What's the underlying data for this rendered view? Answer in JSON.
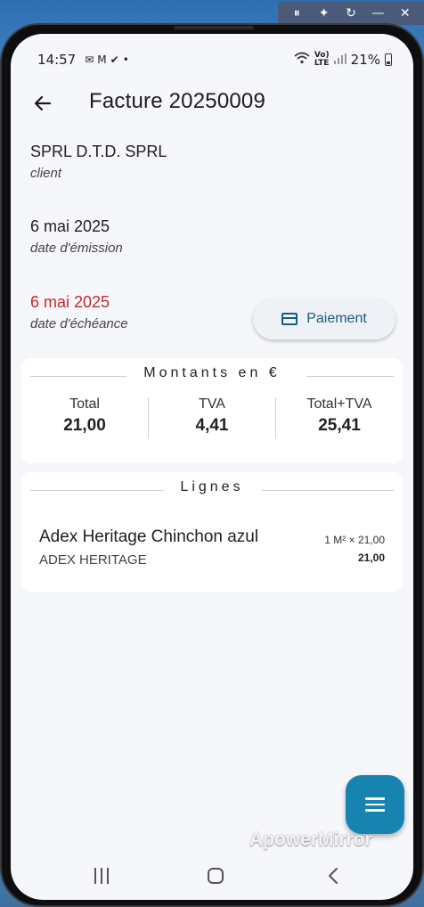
{
  "mirror_toolbar": {
    "icons": [
      "pause-icon",
      "pin-icon",
      "rotate-icon",
      "minimize-icon",
      "close-icon"
    ],
    "glyphs": [
      "⏸",
      "✦",
      "↻",
      "—",
      "✕"
    ]
  },
  "status_bar": {
    "time": "14:57",
    "network_top": "Vo)",
    "network_bottom": "LTE",
    "battery": "21%"
  },
  "app_bar": {
    "title": "Facture 20250009"
  },
  "invoice": {
    "client_value": "SPRL D.T.D. SPRL",
    "client_label": "client",
    "issue_date": "6 mai 2025",
    "issue_label": "date d'émission",
    "due_date": "6 mai 2025",
    "due_label": "date d'échéance",
    "due_color": "#c62828"
  },
  "payment_button": {
    "label": "Paiement"
  },
  "amounts": {
    "title": "Montants en €",
    "total_label": "Total",
    "total_value": "21,00",
    "vat_label": "TVA",
    "vat_value": "4,41",
    "total_vat_label": "Total+TVA",
    "total_vat_value": "25,41"
  },
  "lines": {
    "title": "Lignes",
    "items": [
      {
        "name": "Adex Heritage Chinchon azul",
        "brand": "ADEX HERITAGE",
        "quantity": "1 M² × 21,00",
        "total": "21,00"
      }
    ]
  },
  "fab": {
    "icon": "menu-icon",
    "color": "#1683b0"
  },
  "watermark": "ApowerMirror"
}
